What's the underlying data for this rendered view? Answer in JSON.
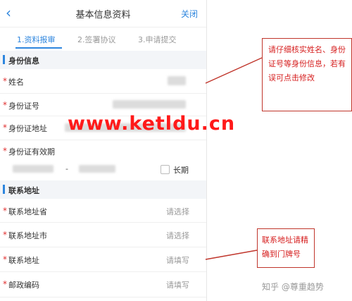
{
  "nav": {
    "back_glyph": "‹",
    "title": "基本信息资料",
    "close_label": "关闭"
  },
  "steps": [
    {
      "label": "1.资料报审",
      "active": true
    },
    {
      "label": "2.签署协议",
      "active": false
    },
    {
      "label": "3.申请提交",
      "active": false
    }
  ],
  "sections": {
    "identity": "身份信息",
    "contact": "联系地址"
  },
  "fields": {
    "name": {
      "label": "姓名",
      "required": true
    },
    "id_number": {
      "label": "身份证号",
      "required": true
    },
    "id_address": {
      "label": "身份证地址",
      "required": true
    },
    "id_validity": {
      "label": "身份证有效期",
      "required": true,
      "separator": "-",
      "long_term_label": "长期"
    },
    "province": {
      "label": "联系地址省",
      "placeholder": "请选择"
    },
    "city": {
      "label": "联系地址市",
      "placeholder": "请选择"
    },
    "address": {
      "label": "联系地址",
      "placeholder": "请填写"
    },
    "postal": {
      "label": "邮政编码",
      "placeholder": "请填写"
    }
  },
  "required_mark": "*",
  "watermark": "www.ketldu.cn",
  "callouts": {
    "verify": "请仔细核实姓名、身份证号等身份信息，若有误可点击修改",
    "address": "联系地址请精确到门牌号"
  },
  "attribution": "知乎 @尊重趋势",
  "colors": {
    "accent": "#2e86de",
    "required": "#e03030",
    "callout": "#c0352b",
    "watermark": "#ff1a1a"
  }
}
